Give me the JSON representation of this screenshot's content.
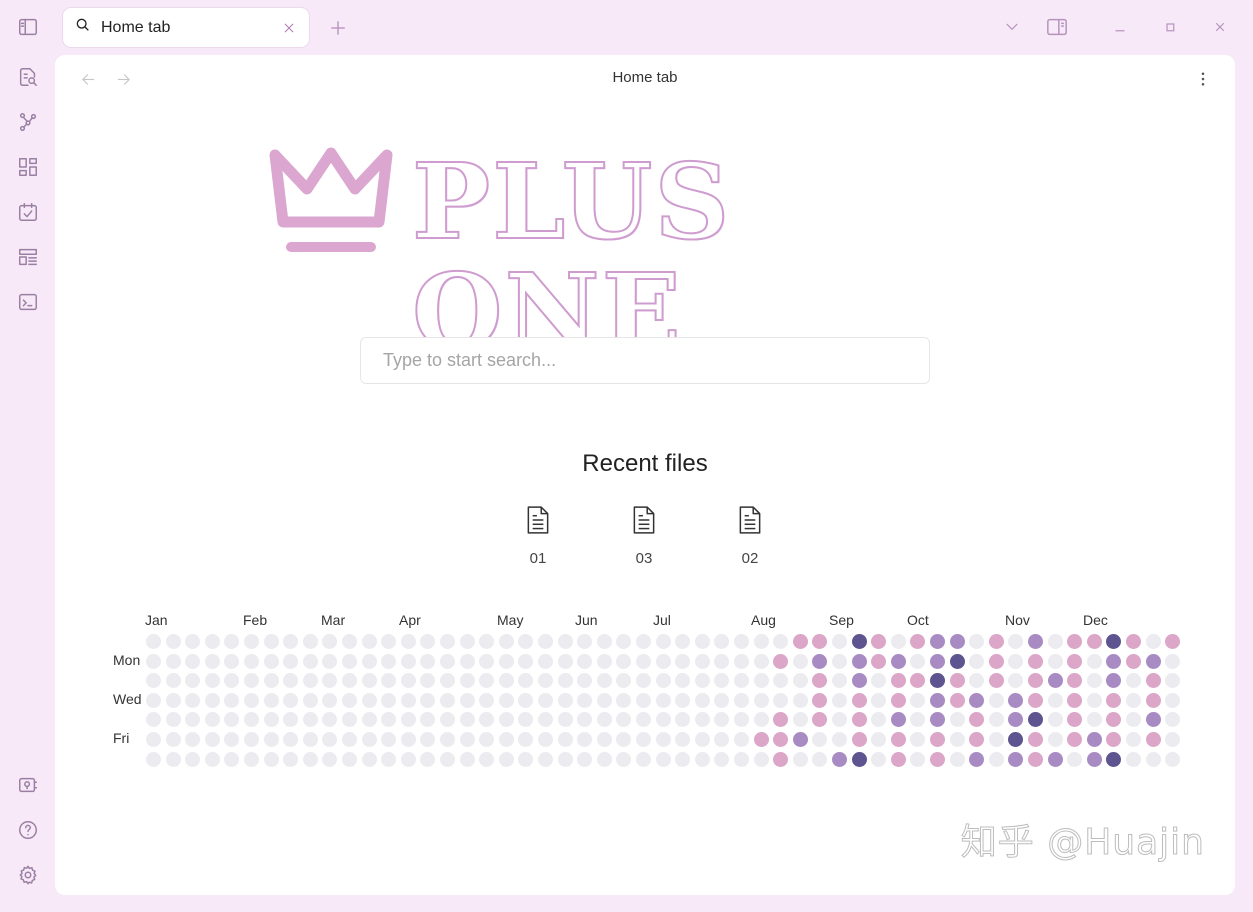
{
  "tab": {
    "title": "Home tab"
  },
  "view": {
    "title": "Home tab"
  },
  "logo": {
    "text": "PLUS ONE"
  },
  "search": {
    "placeholder": "Type to start search..."
  },
  "recent": {
    "heading": "Recent files",
    "files": [
      "01",
      "03",
      "02"
    ]
  },
  "heatmap": {
    "months": [
      "Jan",
      "Feb",
      "Mar",
      "Apr",
      "May",
      "Jun",
      "Jul",
      "Aug",
      "Sep",
      "Oct",
      "Nov",
      "Dec"
    ],
    "day_labels": [
      "Mon",
      "Wed",
      "Fri"
    ],
    "colors": [
      "#ebebf0",
      "#dba6c8",
      "#a98bc4",
      "#5d5490"
    ],
    "active_weeks": [
      [
        0,
        0,
        0,
        0,
        0,
        1,
        0
      ],
      [
        0,
        1,
        0,
        0,
        1,
        1,
        1
      ],
      [
        1,
        0,
        0,
        0,
        0,
        2,
        0
      ],
      [
        1,
        2,
        1,
        1,
        1,
        0,
        0
      ],
      [
        0,
        0,
        0,
        0,
        0,
        0,
        2
      ],
      [
        3,
        2,
        2,
        1,
        1,
        1,
        3
      ],
      [
        1,
        1,
        0,
        0,
        0,
        0,
        0
      ],
      [
        0,
        2,
        1,
        1,
        2,
        1,
        1
      ],
      [
        1,
        0,
        1,
        0,
        0,
        0,
        0
      ],
      [
        2,
        2,
        3,
        2,
        2,
        1,
        1
      ],
      [
        2,
        3,
        1,
        1,
        0,
        0,
        0
      ],
      [
        0,
        0,
        0,
        2,
        1,
        1,
        2
      ],
      [
        1,
        1,
        1,
        0,
        0,
        0,
        0
      ],
      [
        0,
        0,
        0,
        2,
        2,
        3,
        2
      ],
      [
        2,
        1,
        1,
        1,
        3,
        1,
        1
      ],
      [
        0,
        0,
        2,
        0,
        0,
        0,
        2
      ],
      [
        1,
        1,
        1,
        1,
        1,
        1,
        0
      ],
      [
        1,
        0,
        0,
        0,
        0,
        2,
        2
      ],
      [
        3,
        2,
        2,
        1,
        1,
        1,
        3
      ],
      [
        1,
        1,
        0,
        0,
        0,
        0,
        0
      ],
      [
        0,
        2,
        1,
        1,
        2,
        1,
        0
      ],
      [
        1,
        0,
        0,
        0,
        0,
        0,
        0
      ]
    ]
  },
  "watermark": "知乎 @Huajin"
}
